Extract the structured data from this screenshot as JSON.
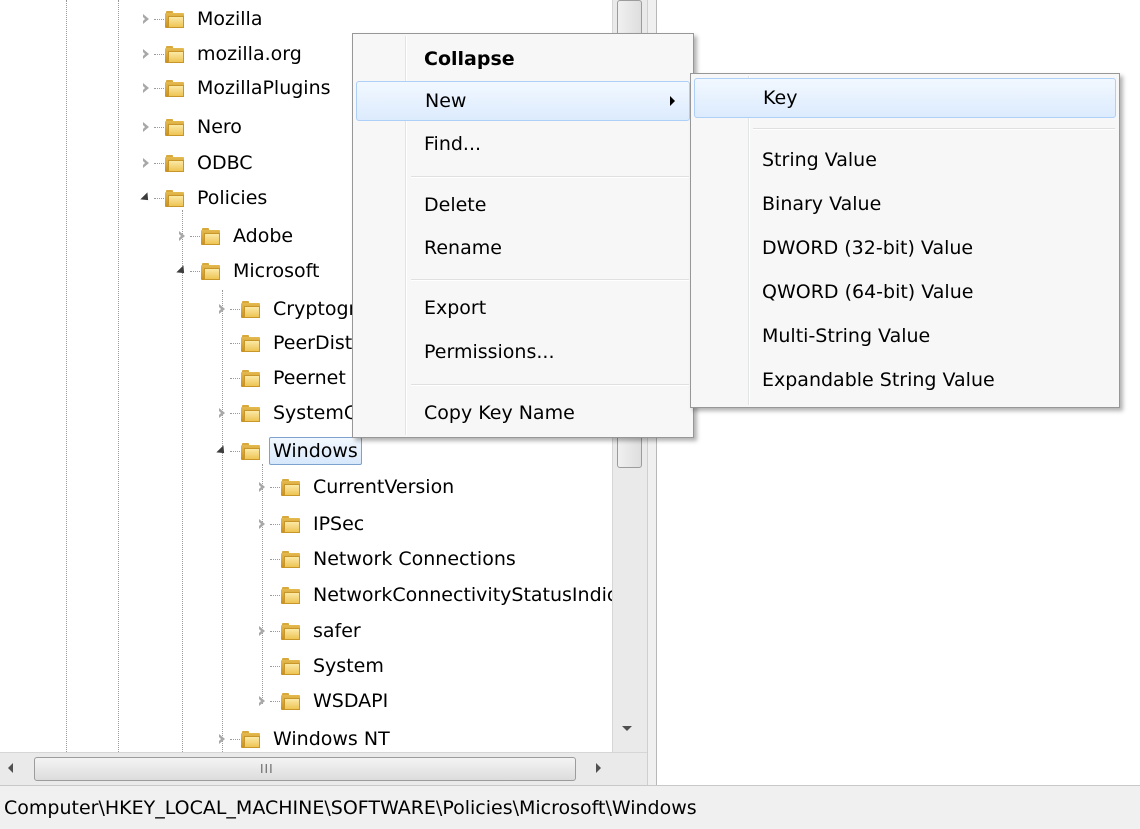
{
  "tree": {
    "items": [
      {
        "label": "Mozilla",
        "expander": "closed"
      },
      {
        "label": "mozilla.org",
        "expander": "closed"
      },
      {
        "label": "MozillaPlugins",
        "expander": "closed"
      },
      {
        "label": "Nero",
        "expander": "closed"
      },
      {
        "label": "ODBC",
        "expander": "closed"
      },
      {
        "label": "Policies",
        "expander": "open"
      },
      {
        "label": "Adobe",
        "expander": "closed"
      },
      {
        "label": "Microsoft",
        "expander": "open"
      },
      {
        "label": "Cryptography",
        "expander": "closed"
      },
      {
        "label": "PeerDist",
        "expander": "none"
      },
      {
        "label": "Peernet",
        "expander": "none"
      },
      {
        "label": "SystemCertificates",
        "expander": "closed"
      },
      {
        "label": "Windows",
        "expander": "open",
        "selected": true
      },
      {
        "label": "CurrentVersion",
        "expander": "closed"
      },
      {
        "label": "IPSec",
        "expander": "closed"
      },
      {
        "label": "Network Connections",
        "expander": "none"
      },
      {
        "label": "NetworkConnectivityStatusIndicator",
        "expander": "none"
      },
      {
        "label": "safer",
        "expander": "closed"
      },
      {
        "label": "System",
        "expander": "none"
      },
      {
        "label": "WSDAPI",
        "expander": "closed"
      },
      {
        "label": "Windows NT",
        "expander": "closed"
      }
    ]
  },
  "context_menu": {
    "items": [
      {
        "label": "Collapse",
        "bold": true
      },
      {
        "label": "New",
        "submenu": true,
        "highlighted": true
      },
      {
        "label": "Find..."
      },
      {
        "label": "Delete"
      },
      {
        "label": "Rename"
      },
      {
        "label": "Export"
      },
      {
        "label": "Permissions..."
      },
      {
        "label": "Copy Key Name"
      }
    ]
  },
  "submenu": {
    "items": [
      {
        "label": "Key",
        "highlighted": true
      },
      {
        "label": "String Value"
      },
      {
        "label": "Binary Value"
      },
      {
        "label": "DWORD (32-bit) Value"
      },
      {
        "label": "QWORD (64-bit) Value"
      },
      {
        "label": "Multi-String Value"
      },
      {
        "label": "Expandable String Value"
      }
    ]
  },
  "scrollbar": {
    "horizontal_grip": "III"
  },
  "status_bar": {
    "path": "Computer\\HKEY_LOCAL_MACHINE\\SOFTWARE\\Policies\\Microsoft\\Windows"
  },
  "colors": {
    "highlight_border": "#aecff7",
    "highlight_fill": "#dcebfd",
    "selection_border": "#7da2ce",
    "folder": "#e4b94f"
  }
}
